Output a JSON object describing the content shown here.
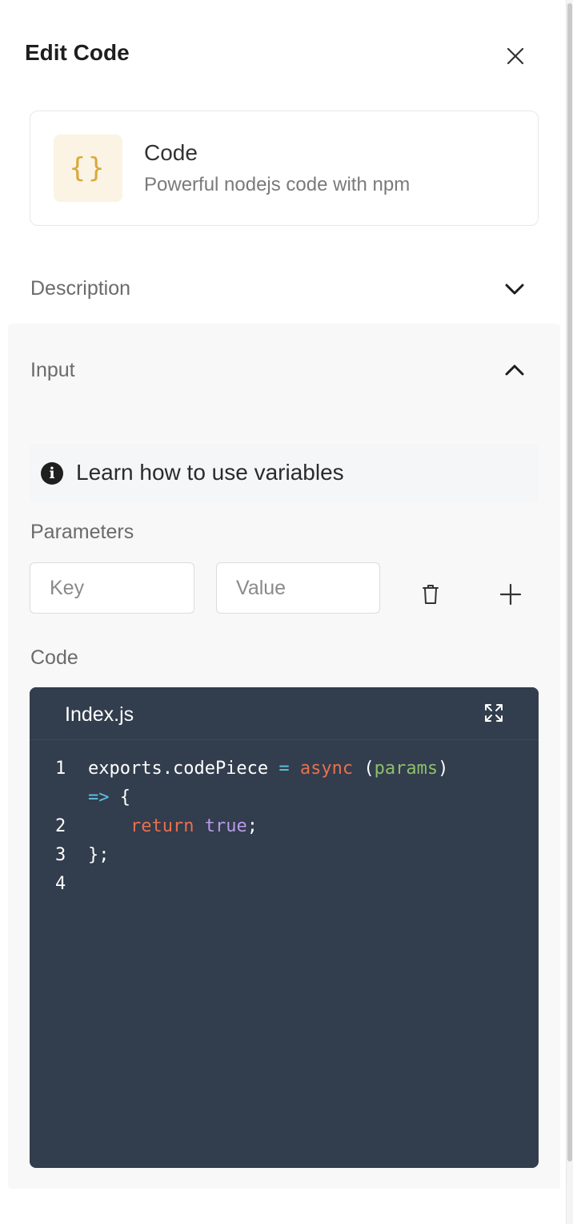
{
  "header": {
    "title": "Edit Code",
    "close_icon": "close-icon"
  },
  "piece": {
    "logo_glyph": "{}",
    "name": "Code",
    "description": "Powerful nodejs code with npm",
    "accent_color": "#d9a93a"
  },
  "description_section": {
    "label": "Description",
    "state": "collapsed"
  },
  "input_section": {
    "label": "Input",
    "state": "expanded",
    "info_text": "Learn how to use variables",
    "parameters_label": "Parameters",
    "key_placeholder": "Key",
    "value_placeholder": "Value",
    "code_label": "Code"
  },
  "editor": {
    "tab_name": "Index.js",
    "background_color": "#323d4d",
    "lines": [
      {
        "number": "1",
        "tokens": [
          {
            "t": "exports.codePiece ",
            "c": "plain"
          },
          {
            "t": "=",
            "c": "op"
          },
          {
            "t": " ",
            "c": "plain"
          },
          {
            "t": "async",
            "c": "kw"
          },
          {
            "t": " (",
            "c": "plain"
          },
          {
            "t": "params",
            "c": "param"
          },
          {
            "t": ")",
            "c": "plain"
          }
        ]
      },
      {
        "number": "",
        "tokens": [
          {
            "t": "=>",
            "c": "op"
          },
          {
            "t": " {",
            "c": "plain"
          }
        ]
      },
      {
        "number": "2",
        "tokens": [
          {
            "t": "    ",
            "c": "plain"
          },
          {
            "t": "return",
            "c": "kw"
          },
          {
            "t": " ",
            "c": "plain"
          },
          {
            "t": "true",
            "c": "bool"
          },
          {
            "t": ";",
            "c": "plain"
          }
        ]
      },
      {
        "number": "3",
        "tokens": [
          {
            "t": "};",
            "c": "plain"
          }
        ]
      },
      {
        "number": "4",
        "tokens": []
      }
    ]
  }
}
